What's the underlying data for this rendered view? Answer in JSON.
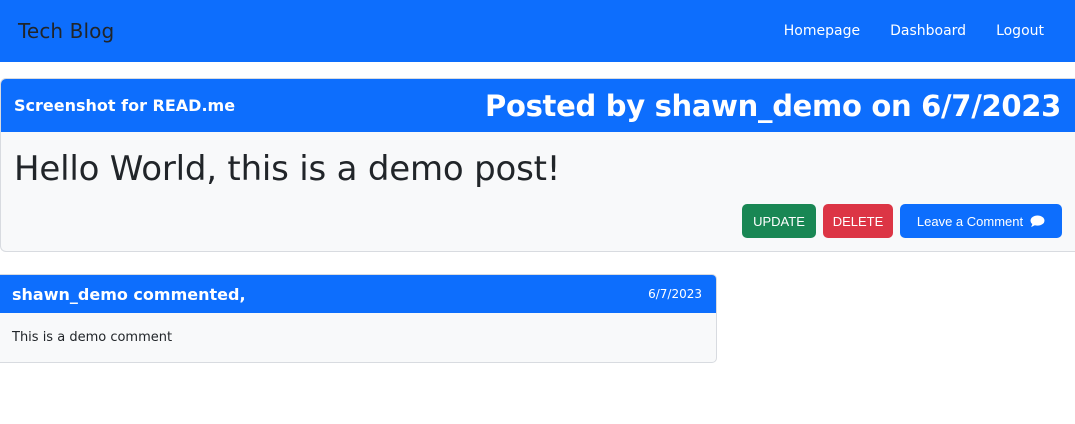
{
  "navbar": {
    "brand": "Tech Blog",
    "links": [
      "Homepage",
      "Dashboard",
      "Logout"
    ]
  },
  "post": {
    "subtitle": "Screenshot for READ.me",
    "meta": "Posted by shawn_demo on 6/7/2023",
    "title": "Hello World, this is a demo post!",
    "buttons": {
      "update": "UPDATE",
      "delete": "DELETE",
      "comment": "Leave a Comment",
      "comment_icon": "chat-bubble-icon"
    }
  },
  "comment": {
    "author": "shawn_demo commented,",
    "date": "6/7/2023",
    "body": "This is a demo comment"
  },
  "colors": {
    "primary": "#0d6efd",
    "success": "#198754",
    "danger": "#dc3545",
    "card_bg": "#f8f9fa"
  }
}
